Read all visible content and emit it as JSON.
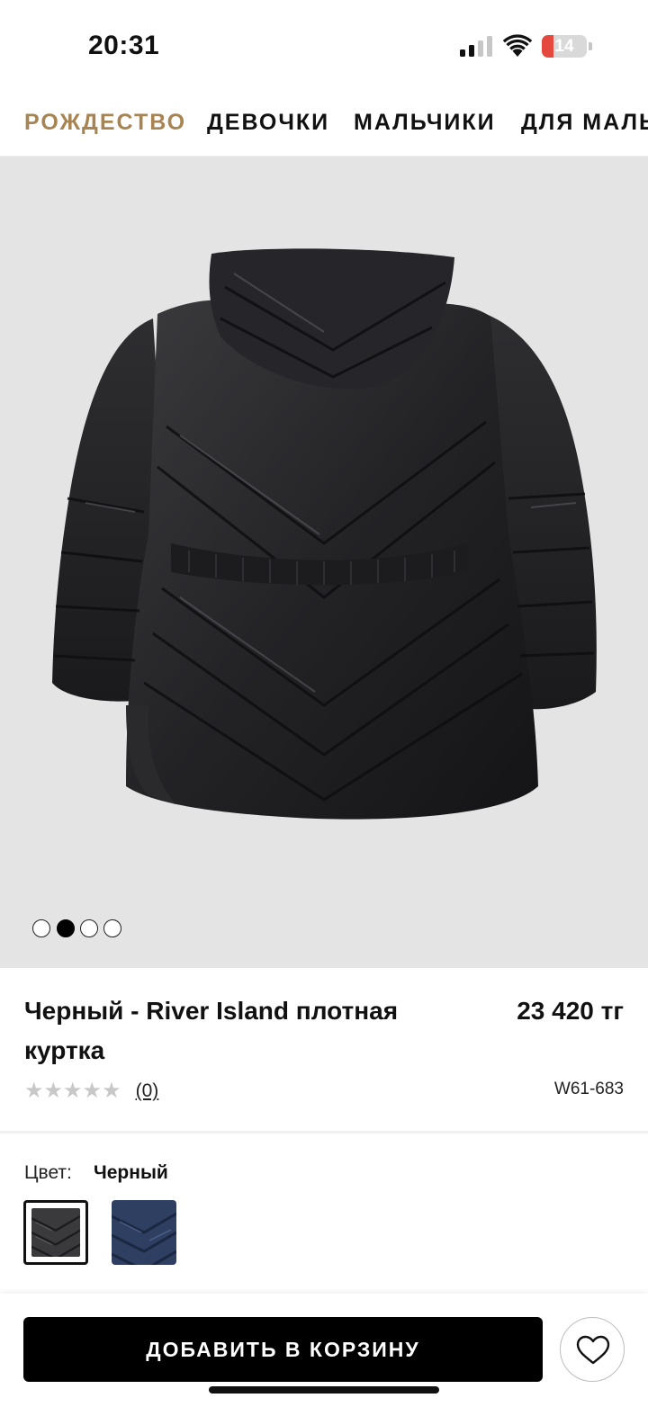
{
  "status_bar": {
    "time": "20:31",
    "battery_level": "14",
    "icons": [
      "signal-icon",
      "wifi-icon",
      "battery-icon"
    ]
  },
  "category_nav": {
    "items": [
      {
        "label": "РОЖДЕСТВО",
        "active": true
      },
      {
        "label": "ДЕВОЧКИ",
        "active": false
      },
      {
        "label": "МАЛЬЧИКИ",
        "active": false
      },
      {
        "label": "ДЛЯ МАЛЫШЕЙ",
        "active": false
      }
    ],
    "active_color": "#a88452"
  },
  "gallery": {
    "image": "black-quilted-jacket-back-view",
    "slide_count": 4,
    "active_index": 1
  },
  "product": {
    "title_line1": "Черный - River Island плотная",
    "title_line2": "куртка",
    "price": "23 420 тг",
    "rating_stars": "★★★★★",
    "rating_value": 0,
    "review_count": "(0)",
    "sku": "W61-683"
  },
  "color_selector": {
    "label": "Цвет:",
    "selected": "Черный",
    "swatches": [
      {
        "name": "black",
        "color": "#3a3a3c",
        "selected": true
      },
      {
        "name": "navy",
        "color": "#2e3f62",
        "selected": false
      }
    ]
  },
  "bottom_bar": {
    "add_to_cart_label": "ДОБАВИТЬ В КОРЗИНУ",
    "wishlist_icon": "heart-icon"
  }
}
